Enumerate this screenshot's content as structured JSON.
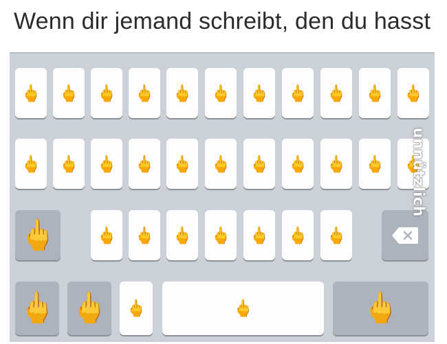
{
  "caption": "Wenn dir jemand schreibt, den du hasst",
  "watermark": "unnützlich",
  "key_glyph": "🖕",
  "icons": {
    "key_symbol": "middle-finger-emoji",
    "backspace": "backspace-icon"
  },
  "colors": {
    "keyboard_bg": "#ccd0d7",
    "key_bg": "#fdfdfd",
    "special_key_bg": "#adb3bd"
  },
  "rows": [
    {
      "name": "row-1",
      "key_count": 11
    },
    {
      "name": "row-2",
      "key_count": 11
    },
    {
      "name": "row-3",
      "key_count": 7,
      "left_special": 1,
      "right_special": "backspace"
    },
    {
      "name": "row-4",
      "keys": [
        "special",
        "special",
        "key",
        "space",
        "special"
      ]
    }
  ]
}
